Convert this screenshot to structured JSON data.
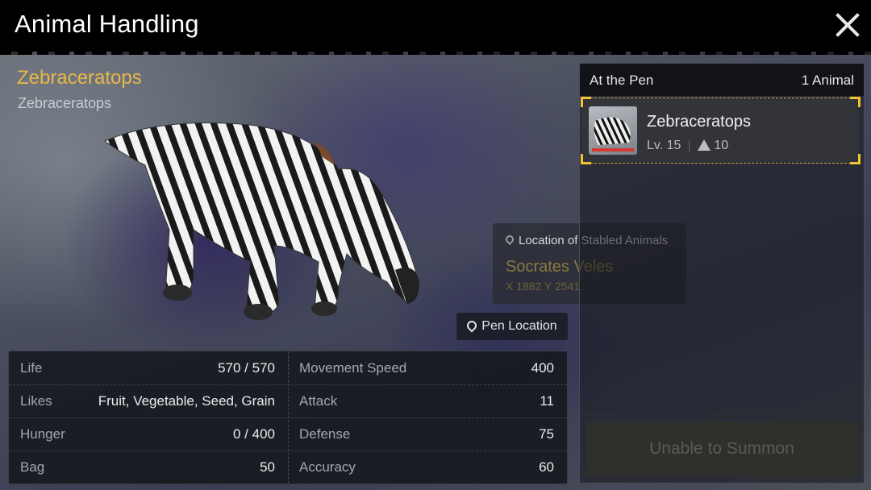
{
  "header": {
    "title": "Animal Handling"
  },
  "animal": {
    "name": "Zebraceratops",
    "species": "Zebraceratops"
  },
  "pen_button": {
    "label": "Pen Location"
  },
  "tooltip": {
    "heading": "Location of Stabled Animals",
    "location_name": "Socrates Veles",
    "coordinates": "X 1882 Y 2541"
  },
  "stats": {
    "left": [
      {
        "label": "Life",
        "value": "570 / 570"
      },
      {
        "label": "Likes",
        "value": "Fruit, Vegetable, Seed, Grain"
      },
      {
        "label": "Hunger",
        "value": "0 / 400"
      },
      {
        "label": "Bag",
        "value": "50"
      }
    ],
    "right": [
      {
        "label": "Movement Speed",
        "value": "400"
      },
      {
        "label": "Attack",
        "value": "11"
      },
      {
        "label": "Defense",
        "value": "75"
      },
      {
        "label": "Accuracy",
        "value": "60"
      }
    ]
  },
  "pen": {
    "title": "At the Pen",
    "count": "1 Animal",
    "animals": [
      {
        "name": "Zebraceratops",
        "level": "Lv. 15",
        "weight": "10"
      }
    ],
    "summon_label": "Unable to Summon"
  },
  "colors": {
    "accent": "#e8b64a",
    "selection": "#f2c230",
    "health_bar": "#d33a30"
  }
}
